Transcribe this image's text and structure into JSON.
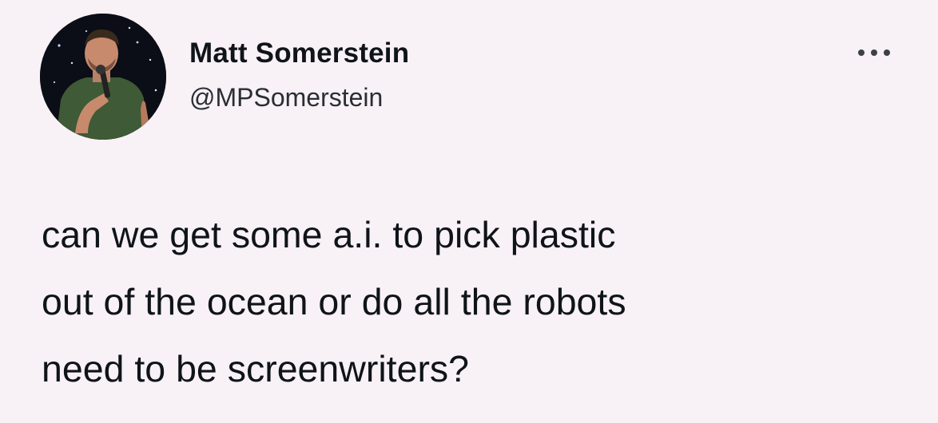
{
  "tweet": {
    "author_name": "Matt Somerstein",
    "author_handle": "@MPSomerstein",
    "text_lines": [
      "can we get some a.i. to pick plastic",
      "out of the ocean or do all the robots",
      "need to be screenwriters?"
    ],
    "avatar": "profile-photo-performer-with-microphone",
    "more_icon": "more-options-icon"
  },
  "colors": {
    "background": "#f8f1f6",
    "text": "#0f1419",
    "handle": "#2a2e33"
  }
}
